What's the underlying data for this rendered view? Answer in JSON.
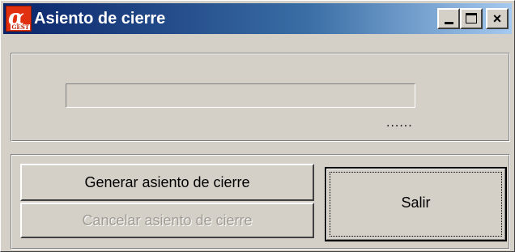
{
  "window": {
    "title": "Asiento de cierre",
    "logo": {
      "icon": "alpha-logo-icon",
      "glyph": "α",
      "subtext": "GEST",
      "color": "#e03010"
    },
    "controls": {
      "minimize_icon": "minimize-icon",
      "maximize_icon": "maximize-icon",
      "close_glyph": "×"
    }
  },
  "progress": {
    "value": 0,
    "status_text": "......"
  },
  "buttons": {
    "generar_label": "Generar asiento de cierre",
    "cancelar_label": "Cancelar asiento de cierre",
    "cancelar_enabled": false,
    "salir_label": "Salir"
  },
  "colors": {
    "titlebar_start": "#0a246a",
    "titlebar_end": "#a6caf0",
    "face": "#d4d0c8",
    "disabled_text": "#a09c94"
  }
}
